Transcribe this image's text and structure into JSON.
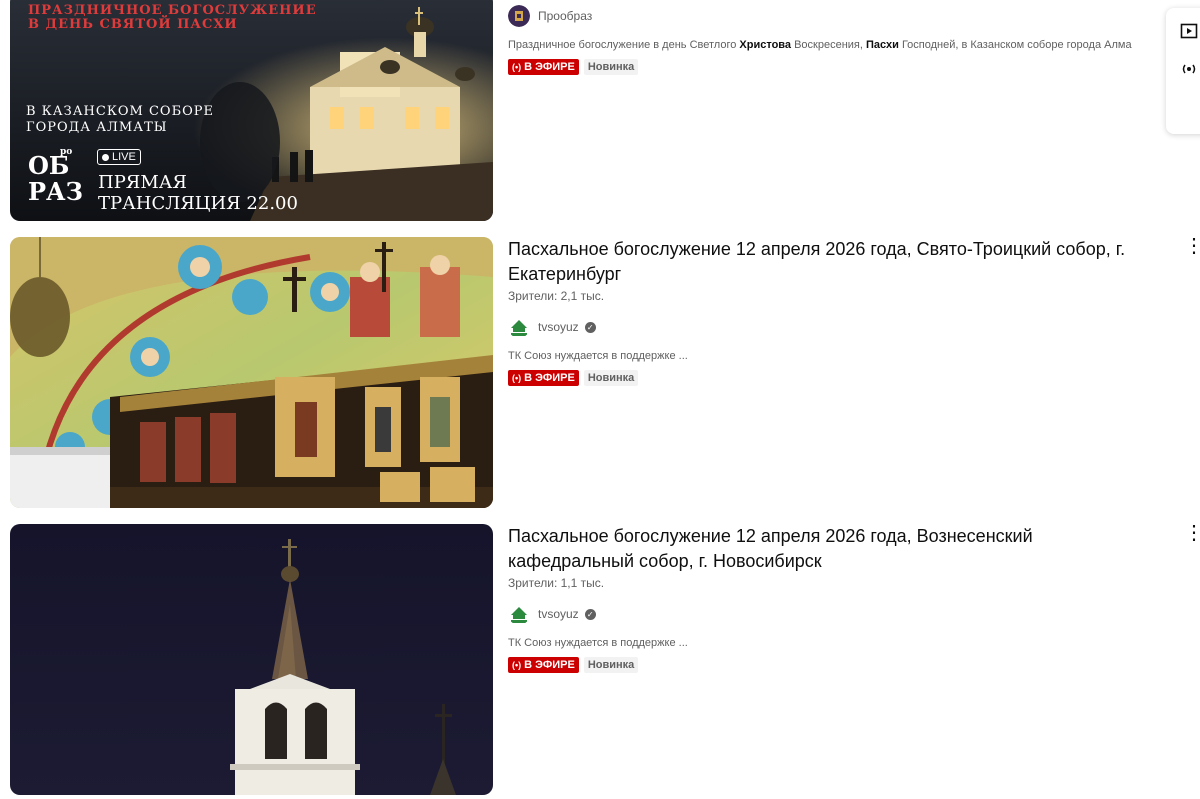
{
  "videos": [
    {
      "overlay": {
        "top_line1": "ПРАЗДНИЧНОЕ БОГОСЛУЖЕНИЕ",
        "top_line2": "В ДЕНЬ СВЯТОЙ ПАСХИ",
        "mid_line1": "В КАЗАНСКОМ СОБОРЕ",
        "mid_line2": "ГОРОДА АЛМАТЫ",
        "logo_top": "ро",
        "logo_a": "ОБ",
        "logo_b": "РАЗ",
        "live_label": "LIVE",
        "cta_line1": "ПРЯМАЯ",
        "cta_line2": "ТРАНСЛЯЦИЯ 22.00"
      },
      "channel": "Прообраз",
      "desc_parts": [
        "Праздничное богослужение в день Светлого ",
        "Христова",
        " Воскресения, ",
        "Пасхи",
        " Господней, в Казанском соборе города Алма"
      ],
      "live_badge": "В ЭФИРЕ",
      "new_badge": "Новинка"
    },
    {
      "title": "Пасхальное богослужение 12 апреля 2026 года, Свято-Троицкий собор, г. Екатеринбург",
      "viewers": "Зрители: 2,1 тыс.",
      "channel": "tvsoyuz",
      "desc": "ТК Союз нуждается в поддержке ...",
      "live_badge": "В ЭФИРЕ",
      "new_badge": "Новинка",
      "more": "⋮"
    },
    {
      "title": "Пасхальное богослужение 12 апреля 2026 года, Вознесенский кафедральный собор, г. Новосибирск",
      "viewers": "Зрители: 1,1 тыс.",
      "channel": "tvsoyuz",
      "desc": "ТК Союз нуждается в поддержке ...",
      "live_badge": "В ЭФИРЕ",
      "new_badge": "Новинка",
      "more": "⋮"
    }
  ],
  "icons": {
    "live_signal": "live-signal-icon",
    "verified": "verified-icon",
    "side_play": "play-queue-icon",
    "side_broadcast": "broadcast-icon"
  },
  "colors": {
    "live_red": "#cc0000",
    "text_secondary": "#606060"
  }
}
